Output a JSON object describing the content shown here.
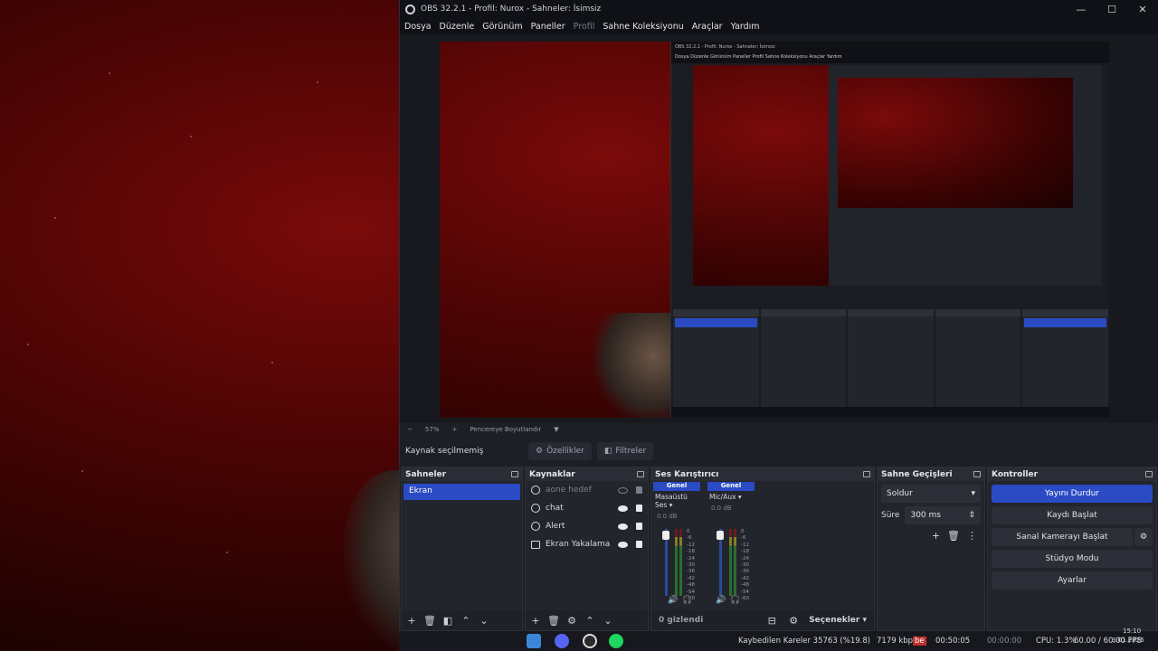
{
  "window": {
    "title": "OBS 32.2.1 - Profil: Nurox - Sahneler: İsimsiz",
    "minimize_glyph": "—",
    "maximize_glyph": "☐",
    "close_glyph": "✕"
  },
  "menu": {
    "file": "Dosya",
    "edit": "Düzenle",
    "view": "Görünüm",
    "docks": "Paneller",
    "profile": "Profil",
    "scene_collection": "Sahne Koleksiyonu",
    "tools": "Araçlar",
    "help": "Yardım"
  },
  "zoom": {
    "minus": "−",
    "percent": "57%",
    "plus": "+",
    "mode": "Pencereye Boyutlandır",
    "caret": "▼"
  },
  "context": {
    "no_source": "Kaynak seçilmemiş",
    "properties": "Özellikler",
    "filters": "Filtreler"
  },
  "scenes": {
    "title": "Sahneler",
    "items": [
      "Ekran"
    ]
  },
  "sources": {
    "title": "Kaynaklar",
    "items": [
      {
        "name": "aone hedef",
        "hidden": true
      },
      {
        "name": "chat",
        "hidden": false
      },
      {
        "name": "Alert",
        "hidden": false
      },
      {
        "name": "Ekran Yakalama",
        "hidden": false
      }
    ]
  },
  "mixer": {
    "title": "Ses Karıştırıcı",
    "channels": [
      {
        "header": "Genel",
        "name": "Masaüstü Ses",
        "db": "0.0 dB"
      },
      {
        "header": "Genel",
        "name": "Mic/Aux",
        "db": "0.0 dB"
      }
    ],
    "scale": [
      "0",
      "-6",
      "-12",
      "-18",
      "-24",
      "-30",
      "-36",
      "-42",
      "-48",
      "-54",
      "-60"
    ],
    "hidden_count": "0 gizlendi",
    "options": "Seçenekler"
  },
  "transitions": {
    "title": "Sahne Geçişleri",
    "selected": "Soldur",
    "duration_label": "Süre",
    "duration_value": "300 ms"
  },
  "controls": {
    "title": "Kontroller",
    "stop_stream": "Yayını Durdur",
    "start_record": "Kaydı Başlat",
    "virtual_cam": "Sanal Kamerayı Başlat",
    "studio_mode": "Stüdyo Modu",
    "settings": "Ayarlar"
  },
  "status": {
    "dropped": "Kaybedilen Kareler 35763 (%19.8)",
    "kbps": "7179 kbps",
    "stream_time": "00:50:05",
    "record_time": "00:00:00",
    "cpu": "CPU: 1.3%",
    "fps": "60.00 / 60.00 FPS"
  },
  "taskbar": {
    "clock_time": "15:10",
    "clock_date": "3.01.2026",
    "badge": "be"
  },
  "nested_obs": {
    "title": "OBS 32.2.1 - Profil: Nurox - Sahneler: İsimsiz",
    "menu": "Dosya  Düzenle  Görünüm  Paneller  Profil  Sahne Koleksiyonu  Araçlar  Yardım"
  },
  "colors": {
    "accent": "#2a4bc4",
    "panel": "#23252d",
    "background": "#1d1f26"
  }
}
